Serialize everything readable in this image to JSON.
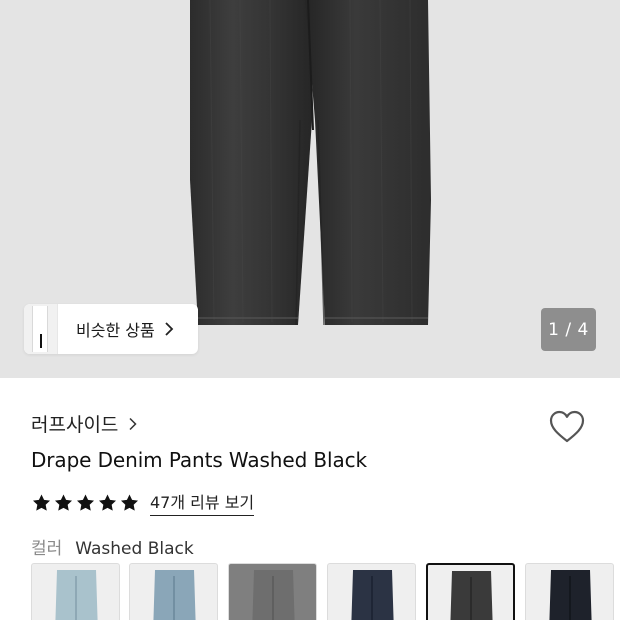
{
  "hero": {
    "similar_products_label": "비슷한 상품",
    "image_counter": "1 / 4"
  },
  "product": {
    "brand": "러프사이드",
    "name": "Drape Denim Pants Washed Black",
    "rating_stars": 5,
    "review_link": "47개 리뷰 보기"
  },
  "color_option": {
    "label": "컬러",
    "selected_value": "Washed Black",
    "swatches": [
      {
        "tone": "#a9c2cc"
      },
      {
        "tone": "#8aa6b8"
      },
      {
        "tone": "#7d7d7d"
      },
      {
        "tone": "#2b3344"
      },
      {
        "tone": "#3a3a3a",
        "selected": true
      },
      {
        "tone": "#1e222b"
      }
    ]
  },
  "icons": {
    "similar_chevron": "chevron-right-icon",
    "brand_chevron": "chevron-right-icon",
    "wishlist": "heart-outline-icon",
    "rating": "star-filled-icon"
  }
}
